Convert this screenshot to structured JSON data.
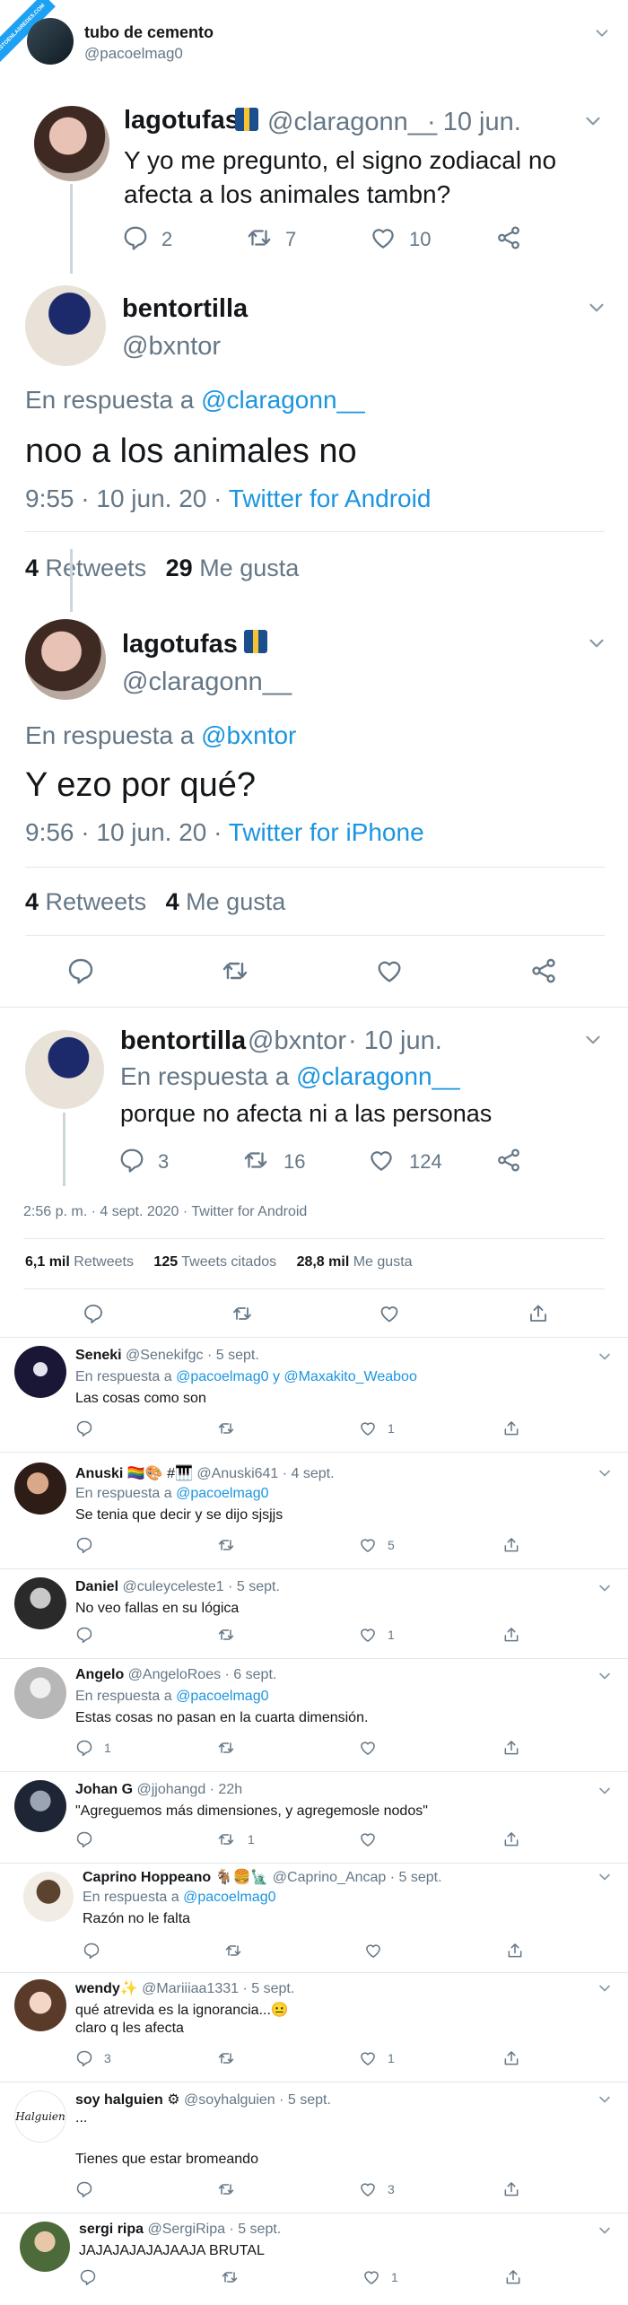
{
  "header": {
    "name": "tubo de cemento",
    "handle": "@pacoelmag0",
    "watermark": "VISTOENLASREDES.COM"
  },
  "t1": {
    "name": "lagotufas",
    "handle": "@claragonn__",
    "date": "· 10 jun.",
    "text_l1": "Y yo me pregunto, el signo zodiacal no",
    "text_l2": "afecta a los animales tambn?",
    "replies": "2",
    "retweets": "7",
    "likes": "10"
  },
  "t2": {
    "name": "bentortilla",
    "handle": "@bxntor",
    "reply_prefix": "En respuesta a",
    "reply_to": "@claragonn__",
    "text": "noo a los animales no",
    "time": "9:55 · 10 jun. 20 ·",
    "client": "Twitter for Android",
    "rt_count": "4",
    "rt_label": "Retweets",
    "likes_count": "29",
    "likes_label": "Me gusta"
  },
  "t3": {
    "name": "lagotufas",
    "handle": "@claragonn__",
    "reply_prefix": "En respuesta a",
    "reply_to": "@bxntor",
    "text": "Y ezo por qué?",
    "time": "9:56 · 10 jun. 20 ·",
    "client": "Twitter for iPhone",
    "rt_count": "4",
    "rt_label": "Retweets",
    "likes_count": "4",
    "likes_label": "Me gusta"
  },
  "t4": {
    "name": "bentortilla",
    "handle": "@bxntor",
    "date": "· 10 jun.",
    "reply_prefix": "En respuesta a",
    "reply_to": "@claragonn__",
    "text": "porque no afecta ni a las personas",
    "replies": "3",
    "retweets": "16",
    "likes": "124"
  },
  "main": {
    "meta": "2:56 p. m. · 4 sept. 2020 · Twitter for Android",
    "rt_count": "6,1 mil",
    "rt_label": "Retweets",
    "quotes_count": "125",
    "quotes_label": "Tweets citados",
    "likes_count": "28,8 mil",
    "likes_label": "Me gusta"
  },
  "replies": [
    {
      "name": "Seneki",
      "handle": "@Senekifgc · 5 sept.",
      "reply_prefix": "En respuesta a",
      "reply_to": "@pacoelmag0 y @Maxakito_Weaboo",
      "text": "Las cosas como son",
      "replies": "",
      "retweets": "",
      "likes": "1"
    },
    {
      "name": "Anuski",
      "emoji": "🏳️‍🌈🎨 #🎹",
      "handle": "@Anuski641 · 4 sept.",
      "reply_prefix": "En respuesta a",
      "reply_to": "@pacoelmag0",
      "text": "Se tenia que decir y se dijo sjsjjs",
      "replies": "",
      "retweets": "",
      "likes": "5"
    },
    {
      "name": "Daniel",
      "handle": "@culeyceleste1 · 5 sept.",
      "text": "No veo fallas en su lógica",
      "replies": "",
      "retweets": "",
      "likes": "1"
    },
    {
      "name": "Angelo",
      "handle": "@AngeloRoes · 6 sept.",
      "reply_prefix": "En respuesta a",
      "reply_to": "@pacoelmag0",
      "text": "Estas cosas no pasan en la cuarta dimensión.",
      "replies": "1",
      "retweets": "",
      "likes": ""
    },
    {
      "name": "Johan G",
      "handle": "@jjohangd · 22h",
      "text": "\"Agreguemos más dimensiones, y agregemosle nodos\"",
      "replies": "",
      "retweets": "1",
      "likes": ""
    },
    {
      "name": "Caprino Hoppeano",
      "emoji": "🐐🍔🗽",
      "handle": "@Caprino_Ancap · 5 sept.",
      "reply_prefix": "En respuesta a",
      "reply_to": "@pacoelmag0",
      "text": "Razón no le falta",
      "replies": "",
      "retweets": "",
      "likes": ""
    },
    {
      "name": "wendy",
      "emoji": "✨",
      "handle": "@Mariiiaa1331 · 5 sept.",
      "text": "qué atrevida es la ignorancia...😐",
      "text2": "claro q les afecta",
      "replies": "3",
      "retweets": "",
      "likes": "1"
    },
    {
      "name": "soy halguien",
      "emoji": "⚙",
      "handle": "@soyhalguien · 5 sept.",
      "text": "...",
      "text2": "Tienes que estar bromeando",
      "avatar_text": "Halguien",
      "replies": "",
      "retweets": "",
      "likes": "3"
    },
    {
      "name": "sergi ripa",
      "handle": "@SergiRipa · 5 sept.",
      "text": "JAJAJAJAJAJAAJA BRUTAL",
      "replies": "",
      "retweets": "",
      "likes": "1"
    }
  ],
  "icons": {
    "reply": "reply-icon",
    "retweet": "retweet-icon",
    "like": "heart-icon",
    "share": "share-icon",
    "more": "chevron-down-icon"
  },
  "colors": {
    "link": "#1b95e0",
    "muted": "#657786",
    "divider": "#e1e8ed"
  }
}
